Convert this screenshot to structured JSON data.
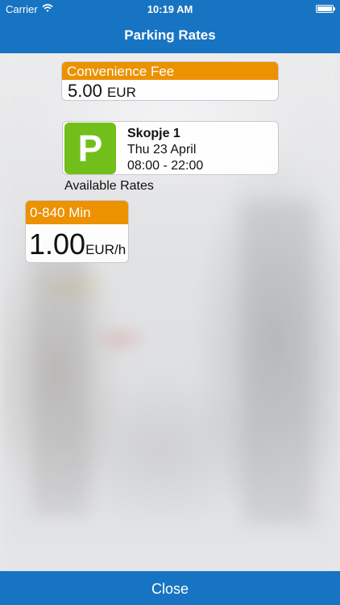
{
  "status_bar": {
    "carrier": "Carrier",
    "time": "10:19 AM",
    "icons": [
      "wifi-icon",
      "battery-icon"
    ]
  },
  "nav": {
    "title": "Parking Rates"
  },
  "convenience_fee": {
    "label": "Convenience Fee",
    "amount": "5.00",
    "currency": "EUR"
  },
  "zone": {
    "icon_letter": "P",
    "name": "Skopje 1",
    "date": "Thu 23 April",
    "hours": "08:00 - 22:00"
  },
  "available_rates": {
    "label": "Available Rates",
    "items": [
      {
        "range": "0-840 Min",
        "price": "1.00",
        "unit": "EUR/h"
      }
    ]
  },
  "footer": {
    "close_label": "Close"
  },
  "colors": {
    "bar_blue": "#1774c2",
    "header_orange": "#ec9100",
    "parking_green": "#72bf1b"
  }
}
